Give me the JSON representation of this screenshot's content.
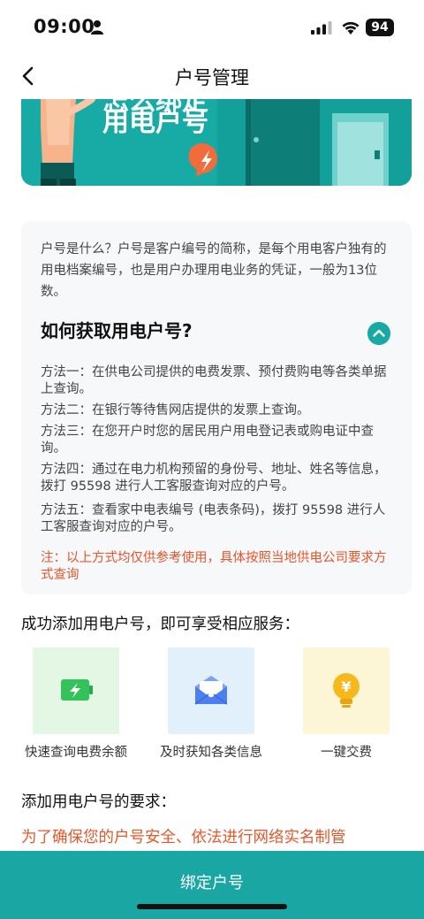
{
  "status_bar": {
    "time": "09:00",
    "battery": "94",
    "icons": [
      "person-icon",
      "signal-icon",
      "wifi-icon",
      "battery-icon"
    ]
  },
  "nav": {
    "back_icon": "chevron-left-icon",
    "title": "户号管理"
  },
  "banner": {
    "title_partial": "怎么绑定",
    "title_line2": "用电户号",
    "colors": {
      "bg": "#17a8a2",
      "badge": "#f26b3a"
    }
  },
  "info": {
    "intro": "户号是什么？户号是客户编号的简称，是每个用电客户独有的用电档案编号，也是用户办理用电业务的凭证，一般为13位数。",
    "how_title": "如何获取用电户号?",
    "collapse_icon": "chevron-up-icon",
    "methods": [
      "方法一：在供电公司提供的电费发票、预付费购电等各类单据上查询。",
      "方法二：在银行等待售网店提供的发票上查询。",
      "方法三：在您开户时您的居民用户用电登记表或购电证中查询。",
      "方法四：通过在电力机构预留的身份号、地址、姓名等信息，拨打 95598 进行人工客服查询对应的户号。",
      "方法五：查看家中电表编号 (电表条码)，拨打 95598 进行人工客服查询对应的户号。"
    ],
    "note": "注：以上方式均仅供参考使用，具体按照当地供电公司要求方式查询"
  },
  "services": {
    "title": "成功添加用电户号，即可享受相应服务：",
    "items": [
      {
        "label": "快速查询电费余额",
        "icon": "battery-charge-icon",
        "tile_color": "#e3f7e4"
      },
      {
        "label": "及时获知各类信息",
        "icon": "envelope-icon",
        "tile_color": "#e2f0fb"
      },
      {
        "label": "一键交费",
        "icon": "coin-bulb-icon",
        "tile_color": "#fdf6d6"
      }
    ]
  },
  "requirements": {
    "title": "添加用电户号的要求：",
    "text": "为了确保您的户号安全、依法进行网络实名制管"
  },
  "bottom": {
    "bind_label": "绑定户号",
    "color": "#1aa6a2"
  }
}
